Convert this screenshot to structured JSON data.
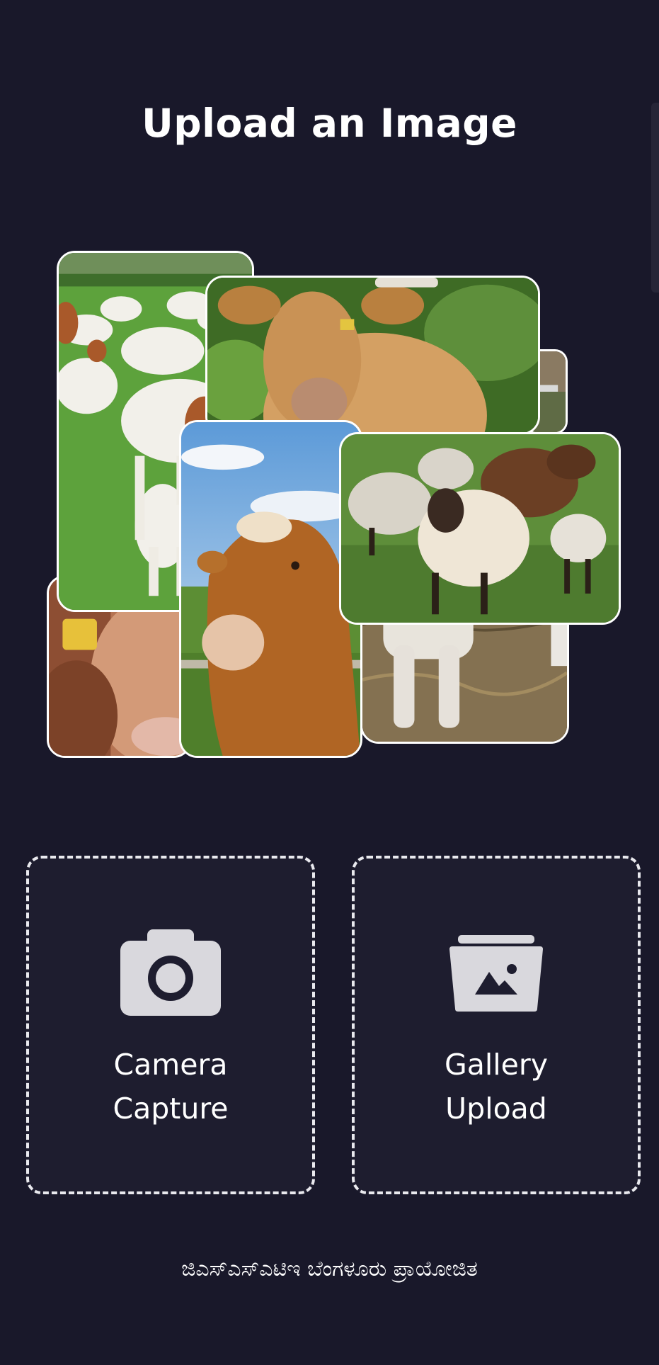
{
  "header": {
    "title": "Upload an Image"
  },
  "collage": {
    "photos": [
      "goats-photo",
      "cow-eating-photo",
      "cow-with-tag-photo",
      "cow-portrait-photo",
      "sheep-flock-photo",
      "lamb-legs-photo",
      "small-edge-photo"
    ]
  },
  "actions": {
    "camera": {
      "line1": "Camera",
      "line2": "Capture",
      "icon": "camera-icon"
    },
    "gallery": {
      "line1": "Gallery",
      "line2": "Upload",
      "icon": "gallery-icon"
    }
  },
  "footer": {
    "text": "ಜಿಎಸ್‌ಎಸ್‌ಎಟಿಇ ಬೆಂಗಳೂರು ಪ್ರಾಯೋಜಿತ"
  },
  "colors": {
    "background": "#19182a",
    "card_background": "#1e1d2f",
    "text": "#ffffff",
    "icon": "#d9d8dd"
  }
}
